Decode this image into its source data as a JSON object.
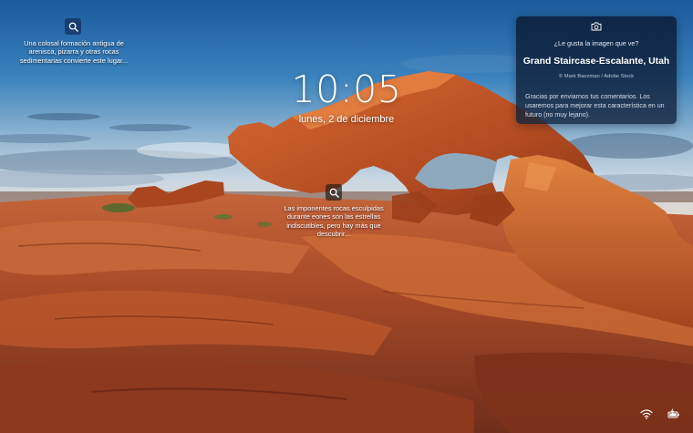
{
  "lock_screen": {
    "time": "10:05",
    "date": "lunes, 2 de diciembre"
  },
  "hotspots": [
    {
      "icon": "search-icon",
      "text": "Una colosal formación antigua de arenisca, pizarra y otras rocas sedimentarias convierte este lugar..."
    },
    {
      "icon": "search-icon",
      "text": "Las imponentes rocas esculpidas durante eones son las estrellas indiscutibles, pero hay más que descubrir..."
    }
  ],
  "info_card": {
    "icon": "camera-icon",
    "question": "¿Le gusta la imagen que ve?",
    "title": "Grand Staircase-Escalante, Utah",
    "credit": "© Mark Baezman / Adobe Stock",
    "body": "Gracias por enviarnos tus comentarios. Los usaremos para mejorar esta característica en un futuro (no muy lejano)."
  },
  "tray": {
    "wifi_icon": "wifi-icon",
    "battery_icon": "battery-icon"
  },
  "colors": {
    "sky_top": "#1b5c9e",
    "sky_horizon": "#c9d8e4",
    "rock": "#c05a2a",
    "card_bg": "#0c1e3a"
  }
}
